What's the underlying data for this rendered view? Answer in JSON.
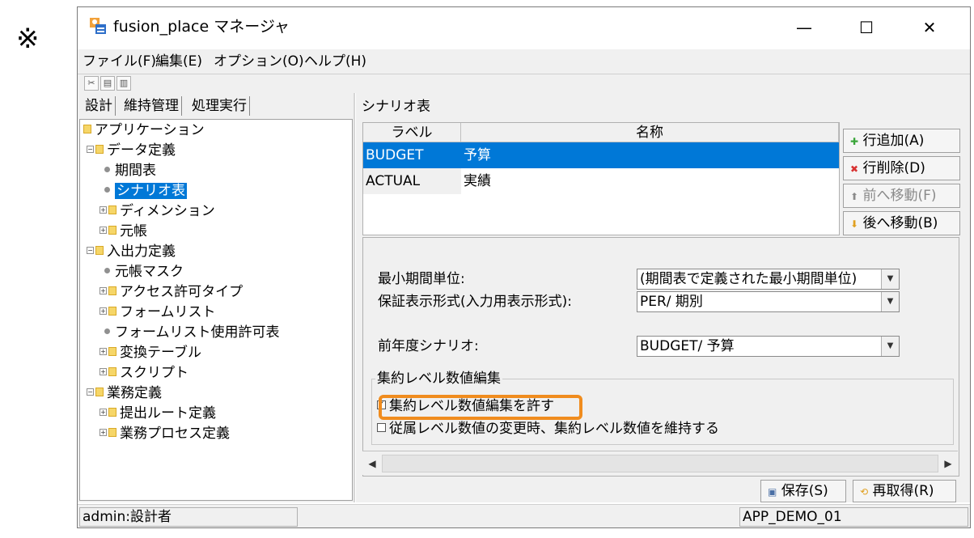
{
  "note_mark": "※",
  "window": {
    "title": "fusion_place マネージャ",
    "minimize": "—",
    "maximize": "☐",
    "close": "✕"
  },
  "menu": {
    "file": "ファイル(F)",
    "edit": "編集(E)",
    "options": "オプション(O)",
    "help": "ヘルプ(H)"
  },
  "toolbar": {
    "cut_icon": "scissors-icon",
    "copy_icon": "copy-icon",
    "paste_icon": "paste-icon"
  },
  "left_tabs": [
    "設計",
    "維持管理",
    "処理実行"
  ],
  "tree": {
    "root": "アプリケーション",
    "data_def": "データ定義",
    "period_table": "期間表",
    "scenario_table": "シナリオ表",
    "dimension": "ディメンション",
    "ledger": "元帳",
    "io_def": "入出力定義",
    "ledger_mask": "元帳マスク",
    "access_type": "アクセス許可タイプ",
    "form_list": "フォームリスト",
    "form_list_perm": "フォームリスト使用許可表",
    "conversion_table": "変換テーブル",
    "script": "スクリプト",
    "business_def": "業務定義",
    "submit_route": "提出ルート定義",
    "business_process": "業務プロセス定義"
  },
  "right": {
    "title": "シナリオ表",
    "grid": {
      "col_label": "ラベル",
      "col_name": "名称",
      "rows": [
        {
          "label": "BUDGET",
          "name": "予算"
        },
        {
          "label": "ACTUAL",
          "name": "実績"
        }
      ]
    },
    "buttons": {
      "add_row": "行追加(A)",
      "delete_row": "行削除(D)",
      "move_up": "前へ移動(F)",
      "move_down": "後へ移動(B)"
    },
    "props": {
      "min_period_label": "最小期間単位:",
      "min_period_value": "(期間表で定義された最小期間単位)",
      "display_format_label": "保証表示形式(入力用表示形式):",
      "display_format_value": "PER/ 期別",
      "prev_year_label": "前年度シナリオ:",
      "prev_year_value": "BUDGET/ 予算",
      "group_title": "集約レベル数値編集",
      "allow_edit": "集約レベル数値編集を許す",
      "keep_on_change": "従属レベル数値の変更時、集約レベル数値を維持する"
    },
    "save": "保存(S)",
    "reload": "再取得(R)"
  },
  "status": {
    "user": "admin:設計者",
    "app": "APP_DEMO_01"
  },
  "colors": {
    "selection": "#0078d7",
    "highlight": "#f08c1e"
  }
}
